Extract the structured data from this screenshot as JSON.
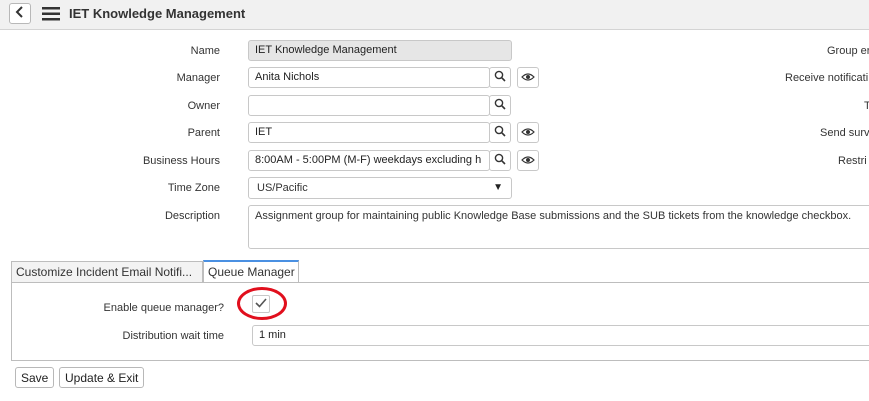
{
  "header": {
    "title": "IET Knowledge Management"
  },
  "form": {
    "name_label": "Name",
    "name_value": "IET Knowledge Management",
    "manager_label": "Manager",
    "manager_value": "Anita Nichols",
    "owner_label": "Owner",
    "owner_value": "",
    "parent_label": "Parent",
    "parent_value": "IET",
    "business_hours_label": "Business Hours",
    "business_hours_value": "8:00AM - 5:00PM (M-F) weekdays excluding h",
    "time_zone_label": "Time Zone",
    "time_zone_value": "US/Pacific",
    "description_label": "Description",
    "description_value": "Assignment group for maintaining public Knowledge Base submissions and the SUB tickets from the knowledge checkbox."
  },
  "right_column": {
    "group_email_label": "Group er",
    "receive_notifications_label": "Receive notificati",
    "t_label": "T",
    "send_survey_label": "Send surv",
    "restrict_label": "Restri"
  },
  "tabs": [
    {
      "label": "Customize Incident Email Notifi..."
    },
    {
      "label": "Queue Manager"
    }
  ],
  "queue_manager": {
    "enable_label": "Enable queue manager?",
    "enable_checked": true,
    "distribution_label": "Distribution wait time",
    "distribution_value": "1 min"
  },
  "footer": {
    "save_label": "Save",
    "update_exit_label": "Update & Exit"
  },
  "colors": {
    "active_tab_accent": "#4a90e2",
    "highlight_ring": "#e10f1d"
  }
}
